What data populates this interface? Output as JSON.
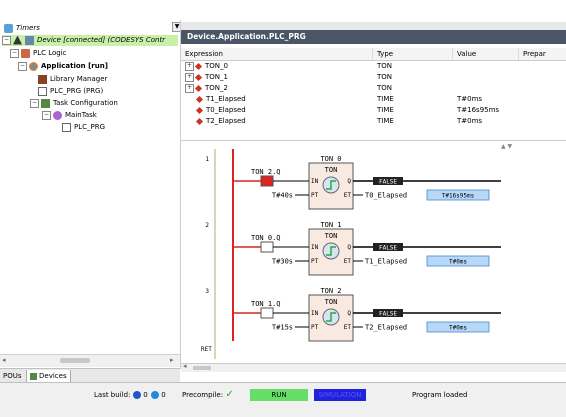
{
  "tree": {
    "timers_label": "Timers",
    "device_label": "Device [connected] (CODESYS Contr",
    "plc_logic_label": "PLC Logic",
    "application_label": "Application [run]",
    "library_manager_label": "Library Manager",
    "plc_prg_label": "PLC_PRG (PRG)",
    "task_config_label": "Task Configuration",
    "main_task_label": "MainTask",
    "plc_prg_call_label": "PLC_PRG"
  },
  "bottom_tabs": {
    "pous_label": "POUs",
    "devices_label": "Devices"
  },
  "watch": {
    "title": "Device.Application.PLC_PRG",
    "headers": {
      "expression": "Expression",
      "type": "Type",
      "value": "Value",
      "prepared": "Prepar"
    },
    "rows": [
      {
        "expression": "TON_0",
        "type": "TON",
        "value": ""
      },
      {
        "expression": "TON_1",
        "type": "TON",
        "value": ""
      },
      {
        "expression": "TON_2",
        "type": "TON",
        "value": ""
      },
      {
        "expression": "T1_Elapsed",
        "type": "TIME",
        "value": "T#0ms"
      },
      {
        "expression": "T0_Elapsed",
        "type": "TIME",
        "value": "T#16s95ms"
      },
      {
        "expression": "T2_Elapsed",
        "type": "TIME",
        "value": "T#0ms"
      }
    ]
  },
  "ladder": {
    "rungs": [
      {
        "number": "1",
        "fb_instance": "TON_0",
        "fb_type": "TON",
        "contact": "TON_2.Q",
        "pt_value": "T#40s",
        "q_state": "FALSE",
        "et_var": "T0_Elapsed",
        "et_value": "T#16s95ms",
        "contact_active": true
      },
      {
        "number": "2",
        "fb_instance": "TON_1",
        "fb_type": "TON",
        "contact": "TON_0.Q",
        "pt_value": "T#30s",
        "q_state": "FALSE",
        "et_var": "T1_Elapsed",
        "et_value": "T#0ms",
        "contact_active": false
      },
      {
        "number": "3",
        "fb_instance": "TON_2",
        "fb_type": "TON",
        "contact": "TON_1.Q",
        "pt_value": "T#15s",
        "q_state": "FALSE",
        "et_var": "T2_Elapsed",
        "et_value": "T#0ms",
        "contact_active": false
      }
    ],
    "ret_label": "RET",
    "pin_in": "IN",
    "pin_pt": "PT",
    "pin_q": "Q",
    "pin_et": "ET"
  },
  "status": {
    "last_build_label": "Last build:",
    "errors_count": "0",
    "warnings_count": "0",
    "precompile_label": "Precompile:",
    "run_label": "RUN",
    "simulation_label": "SIMULATION",
    "program_label": "Program loaded"
  },
  "colors": {
    "rail_red": "#dd2222",
    "watch_title_bg": "#4a5566",
    "device_highlight": "#c8f0a8",
    "run_green": "#66dd66",
    "et_value_bg": "#b8d8f8"
  }
}
